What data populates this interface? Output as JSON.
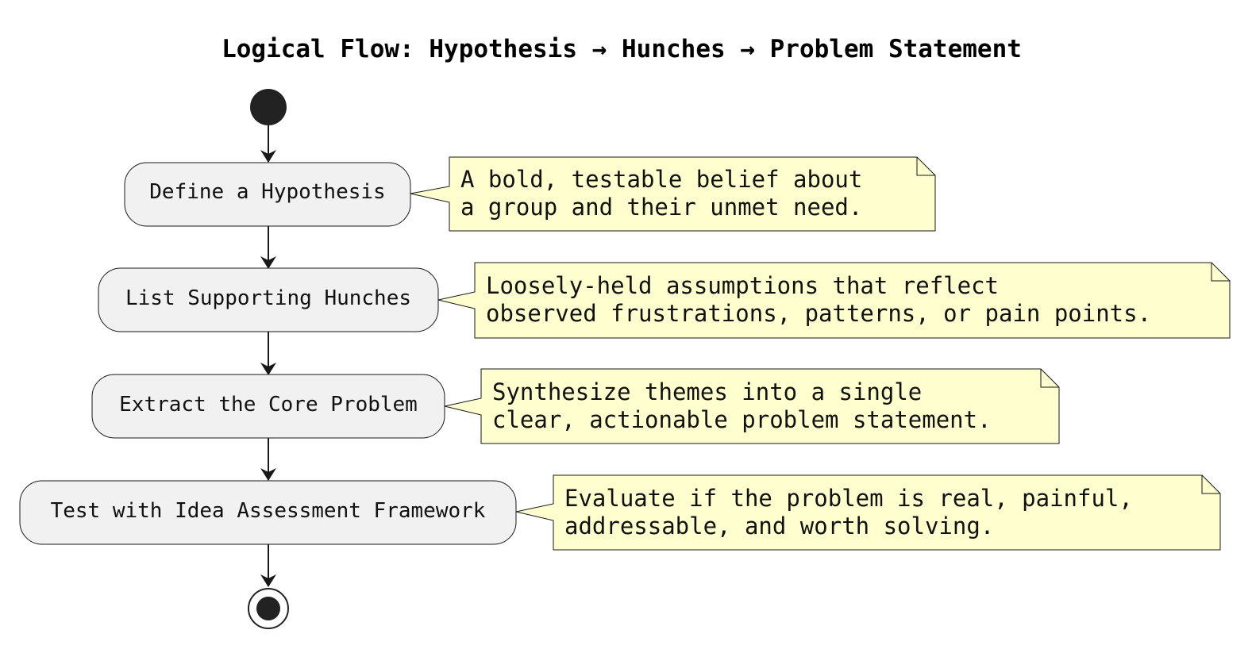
{
  "title": "Logical Flow: Hypothesis → Hunches → Problem Statement",
  "colors": {
    "activity_fill": "#f1f1f1",
    "activity_border": "#181818",
    "note_fill": "#fefece",
    "note_border": "#181818",
    "arrow": "#181818",
    "node": "#222222"
  },
  "start_node": {
    "icon": "start-circle"
  },
  "end_node": {
    "icon": "end-bullseye"
  },
  "steps": [
    {
      "label": "Define a Hypothesis",
      "note": [
        "A bold, testable belief about",
        "a group and their unmet need."
      ]
    },
    {
      "label": "List Supporting Hunches",
      "note": [
        "Loosely-held assumptions that reflect",
        "observed frustrations, patterns, or pain points."
      ]
    },
    {
      "label": "Extract the Core Problem",
      "note": [
        "Synthesize themes into a single",
        "clear, actionable problem statement."
      ]
    },
    {
      "label": "Test with Idea Assessment Framework",
      "note": [
        "Evaluate if the problem is real, painful,",
        "addressable, and worth solving."
      ]
    }
  ]
}
